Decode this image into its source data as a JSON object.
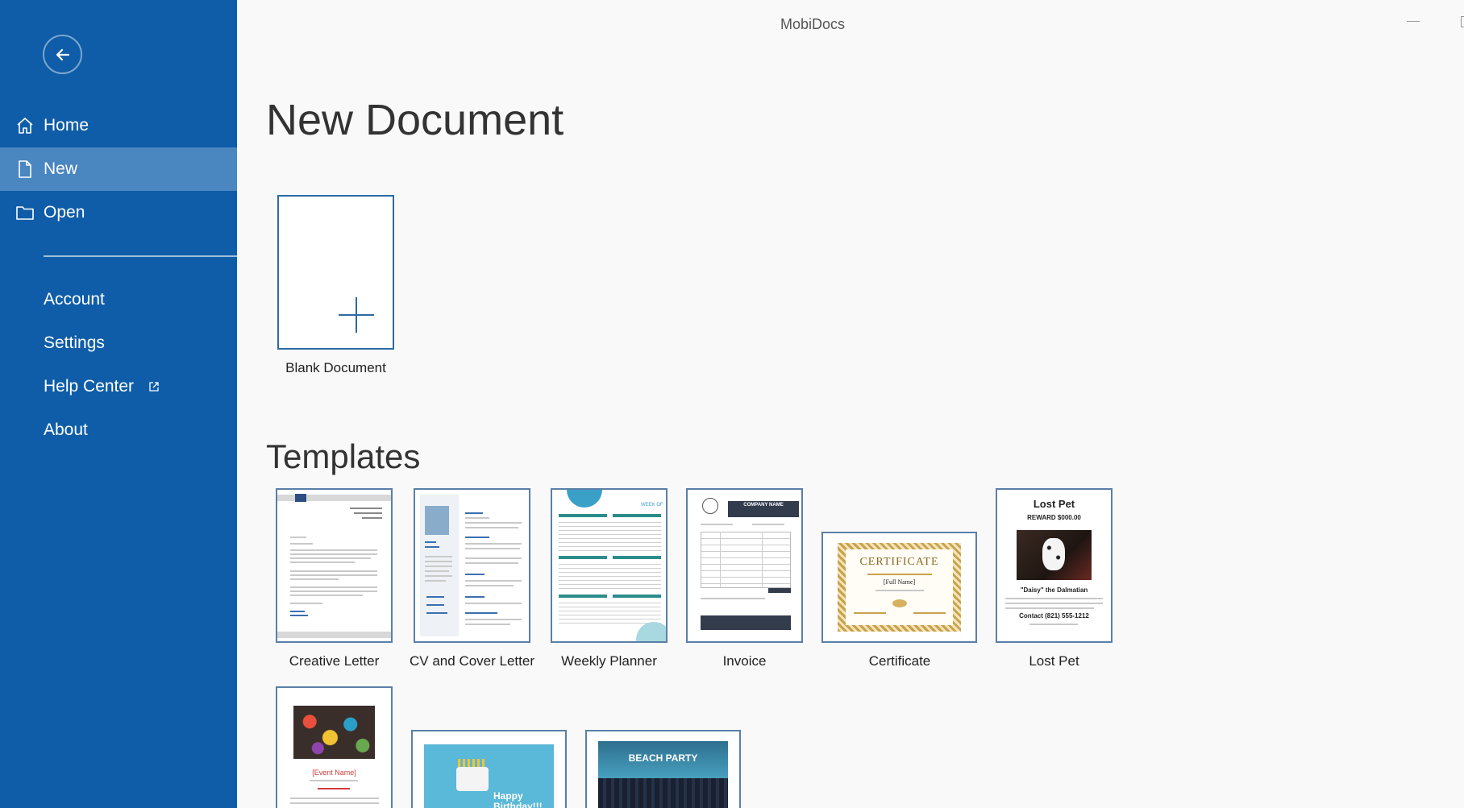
{
  "app": {
    "title": "MobiDocs"
  },
  "sidebar": {
    "items": [
      {
        "label": "Home"
      },
      {
        "label": "New"
      },
      {
        "label": "Open"
      }
    ],
    "secondary": [
      {
        "label": "Account"
      },
      {
        "label": "Settings"
      },
      {
        "label": "Help Center"
      },
      {
        "label": "About"
      }
    ]
  },
  "main": {
    "title": "New Document",
    "blank": {
      "label": "Blank Document"
    },
    "templates_title": "Templates",
    "templates": [
      {
        "label": "Creative Letter"
      },
      {
        "label": "CV and Cover Letter"
      },
      {
        "label": "Weekly Planner"
      },
      {
        "label": "Invoice"
      },
      {
        "label": "Certificate"
      },
      {
        "label": "Lost Pet"
      }
    ],
    "thumb_text": {
      "planner_week": "WEEK OF",
      "invoice_company": "COMPANY NAME",
      "certificate_title": "CERTIFICATE",
      "certificate_name": "[Full Name]",
      "lostpet_title": "Lost Pet",
      "lostpet_reward": "REWARD $000.00",
      "lostpet_name": "\"Daisy\" the Dalmatian",
      "lostpet_contact": "Contact (821) 555-1212",
      "event_name": "[Event Name]",
      "birthday_text": "Happy Birthday!!!",
      "beach_text": "BEACH PARTY"
    }
  },
  "colors": {
    "sidebar": "#0f5da8",
    "active": "#4a86c0",
    "accent": "#2d6aa4"
  }
}
